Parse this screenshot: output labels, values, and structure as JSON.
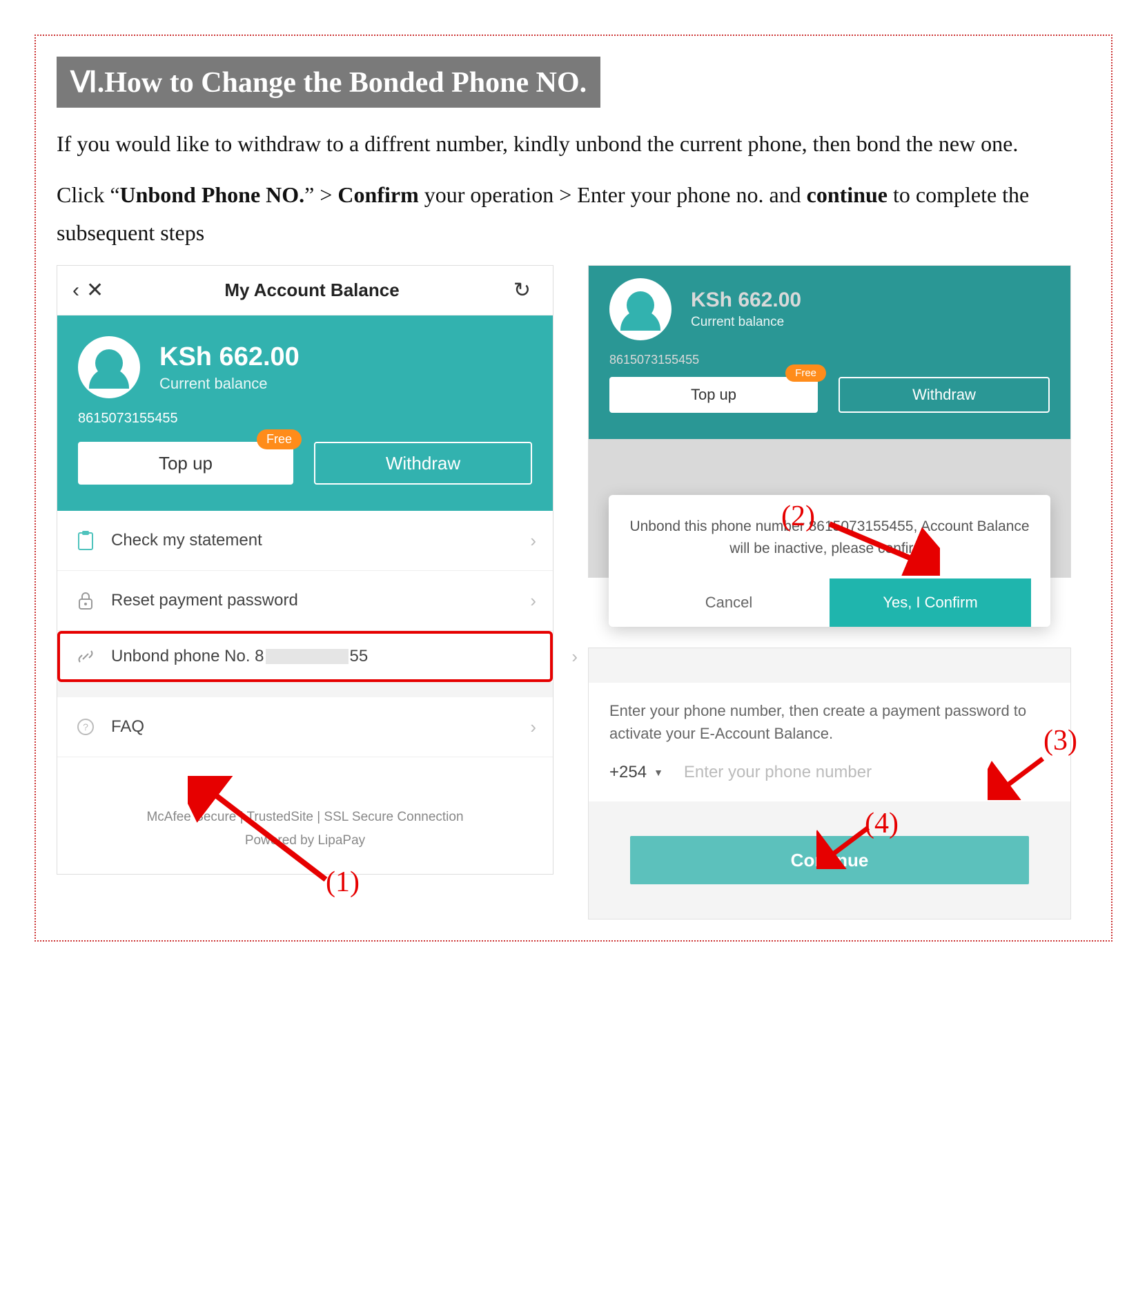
{
  "section_title": "Ⅵ.How to Change the  Bonded Phone NO.",
  "intro": {
    "line1a": "If you would like to withdraw to a diffrent number, kindly unbond the current phone, then bond the new one.",
    "line2_pre": "Click “",
    "unbond": "Unbond Phone NO.",
    "line2_mid1": "” > ",
    "confirm": "Confirm",
    "line2_mid2": " your operation > Enter your phone no. and ",
    "continue": "continue",
    "line2_end": " to complete the subsequent steps"
  },
  "screen1": {
    "title": "My Account Balance",
    "amount": "KSh 662.00",
    "sub": "Current balance",
    "phone": "8615073155455",
    "topup": "Top up",
    "free": "Free",
    "withdraw": "Withdraw",
    "menu": {
      "statement": "Check my statement",
      "reset": "Reset payment password",
      "unbond_prefix": "Unbond phone No. 8",
      "unbond_suffix": "55",
      "faq": "FAQ"
    },
    "footer1": "McAfee Secure | TrustedSite | SSL Secure Connection",
    "footer2": "Powered by LipaPay"
  },
  "screen2": {
    "amount": "KSh 662.00",
    "sub": "Current balance",
    "phone": "8615073155455",
    "topup": "Top up",
    "free": "Free",
    "withdraw": "Withdraw",
    "modal_text": "Unbond this phone number 8615073155455, Account Balance will be inactive, please confirm.",
    "cancel": "Cancel",
    "confirm": "Yes, I Confirm"
  },
  "screen3": {
    "desc": "Enter your phone number, then create a payment password to activate your E-Account Balance.",
    "cc": "+254",
    "placeholder": "Enter your phone number",
    "continue": "Continue"
  },
  "annotations": {
    "a1": "(1)",
    "a2": "(2)",
    "a3": "(3)",
    "a4": "(4)"
  }
}
